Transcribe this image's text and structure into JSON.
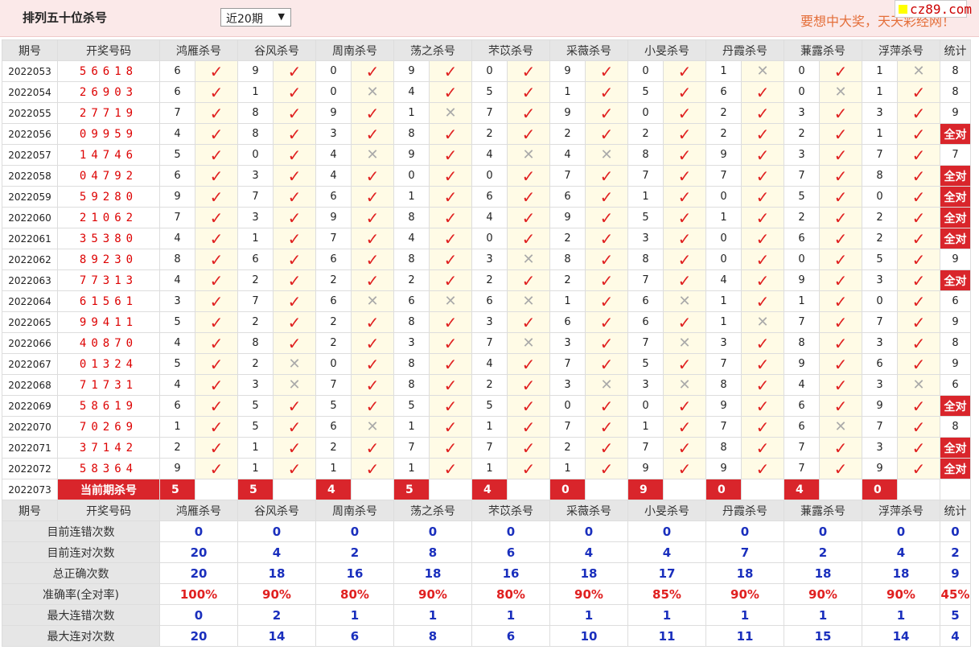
{
  "header": {
    "title": "排列五十位杀号",
    "period_select": "近20期",
    "slogan": "要想中大奖，天天彩经网！",
    "logo": "cz89.com"
  },
  "columns": {
    "period": "期号",
    "open": "开奖号码",
    "experts": [
      "鸿雁杀号",
      "谷风杀号",
      "周南杀号",
      "荡之杀号",
      "芣苡杀号",
      "采薇杀号",
      "小旻杀号",
      "丹霞杀号",
      "蒹露杀号",
      "浮萍杀号"
    ],
    "stat": "统计"
  },
  "all_correct_label": "全对",
  "rows": [
    {
      "period": "2022053",
      "open": "56618",
      "kills": [
        6,
        9,
        0,
        9,
        0,
        9,
        0,
        1,
        0,
        1
      ],
      "ok": [
        1,
        1,
        1,
        1,
        1,
        1,
        1,
        0,
        1,
        0
      ],
      "stat": "8"
    },
    {
      "period": "2022054",
      "open": "26903",
      "kills": [
        6,
        1,
        0,
        4,
        5,
        1,
        5,
        6,
        0,
        1
      ],
      "ok": [
        1,
        1,
        0,
        1,
        1,
        1,
        1,
        1,
        0,
        1
      ],
      "stat": "8"
    },
    {
      "period": "2022055",
      "open": "27719",
      "kills": [
        7,
        8,
        9,
        1,
        7,
        9,
        0,
        2,
        3,
        3
      ],
      "ok": [
        1,
        1,
        1,
        0,
        1,
        1,
        1,
        1,
        1,
        1
      ],
      "stat": "9"
    },
    {
      "period": "2022056",
      "open": "09959",
      "kills": [
        4,
        8,
        3,
        8,
        2,
        2,
        2,
        2,
        2,
        1
      ],
      "ok": [
        1,
        1,
        1,
        1,
        1,
        1,
        1,
        1,
        1,
        1
      ],
      "stat": "全对"
    },
    {
      "period": "2022057",
      "open": "14746",
      "kills": [
        5,
        0,
        4,
        9,
        4,
        4,
        8,
        9,
        3,
        7
      ],
      "ok": [
        1,
        1,
        0,
        1,
        0,
        0,
        1,
        1,
        1,
        1
      ],
      "stat": "7"
    },
    {
      "period": "2022058",
      "open": "04792",
      "kills": [
        6,
        3,
        4,
        0,
        0,
        7,
        7,
        7,
        7,
        8
      ],
      "ok": [
        1,
        1,
        1,
        1,
        1,
        1,
        1,
        1,
        1,
        1
      ],
      "stat": "全对"
    },
    {
      "period": "2022059",
      "open": "59280",
      "kills": [
        9,
        7,
        6,
        1,
        6,
        6,
        1,
        0,
        5,
        0
      ],
      "ok": [
        1,
        1,
        1,
        1,
        1,
        1,
        1,
        1,
        1,
        1
      ],
      "stat": "全对"
    },
    {
      "period": "2022060",
      "open": "21062",
      "kills": [
        7,
        3,
        9,
        8,
        4,
        9,
        5,
        1,
        2,
        2
      ],
      "ok": [
        1,
        1,
        1,
        1,
        1,
        1,
        1,
        1,
        1,
        1
      ],
      "stat": "全对"
    },
    {
      "period": "2022061",
      "open": "35380",
      "kills": [
        4,
        1,
        7,
        4,
        0,
        2,
        3,
        0,
        6,
        2
      ],
      "ok": [
        1,
        1,
        1,
        1,
        1,
        1,
        1,
        1,
        1,
        1
      ],
      "stat": "全对"
    },
    {
      "period": "2022062",
      "open": "89230",
      "kills": [
        8,
        6,
        6,
        8,
        3,
        8,
        8,
        0,
        0,
        5
      ],
      "ok": [
        1,
        1,
        1,
        1,
        0,
        1,
        1,
        1,
        1,
        1
      ],
      "stat": "9"
    },
    {
      "period": "2022063",
      "open": "77313",
      "kills": [
        4,
        2,
        2,
        2,
        2,
        2,
        7,
        4,
        9,
        3
      ],
      "ok": [
        1,
        1,
        1,
        1,
        1,
        1,
        1,
        1,
        1,
        1
      ],
      "stat": "全对"
    },
    {
      "period": "2022064",
      "open": "61561",
      "kills": [
        3,
        7,
        6,
        6,
        6,
        1,
        6,
        1,
        1,
        0
      ],
      "ok": [
        1,
        1,
        0,
        0,
        0,
        1,
        0,
        1,
        1,
        1
      ],
      "stat": "6"
    },
    {
      "period": "2022065",
      "open": "99411",
      "kills": [
        5,
        2,
        2,
        8,
        3,
        6,
        6,
        1,
        7,
        7
      ],
      "ok": [
        1,
        1,
        1,
        1,
        1,
        1,
        1,
        0,
        1,
        1
      ],
      "stat": "9"
    },
    {
      "period": "2022066",
      "open": "40870",
      "kills": [
        4,
        8,
        2,
        3,
        7,
        3,
        7,
        3,
        8,
        3
      ],
      "ok": [
        1,
        1,
        1,
        1,
        0,
        1,
        0,
        1,
        1,
        1
      ],
      "stat": "8"
    },
    {
      "period": "2022067",
      "open": "01324",
      "kills": [
        5,
        2,
        0,
        8,
        4,
        7,
        5,
        7,
        9,
        6
      ],
      "ok": [
        1,
        0,
        1,
        1,
        1,
        1,
        1,
        1,
        1,
        1
      ],
      "stat": "9"
    },
    {
      "period": "2022068",
      "open": "71731",
      "kills": [
        4,
        3,
        7,
        8,
        2,
        3,
        3,
        8,
        4,
        3
      ],
      "ok": [
        1,
        0,
        1,
        1,
        1,
        0,
        0,
        1,
        1,
        0
      ],
      "stat": "6"
    },
    {
      "period": "2022069",
      "open": "58619",
      "kills": [
        6,
        5,
        5,
        5,
        5,
        0,
        0,
        9,
        6,
        9
      ],
      "ok": [
        1,
        1,
        1,
        1,
        1,
        1,
        1,
        1,
        1,
        1
      ],
      "stat": "全对"
    },
    {
      "period": "2022070",
      "open": "70269",
      "kills": [
        1,
        5,
        6,
        1,
        1,
        7,
        1,
        7,
        6,
        7
      ],
      "ok": [
        1,
        1,
        0,
        1,
        1,
        1,
        1,
        1,
        0,
        1
      ],
      "stat": "8"
    },
    {
      "period": "2022071",
      "open": "37142",
      "kills": [
        2,
        1,
        2,
        7,
        7,
        2,
        7,
        8,
        7,
        3
      ],
      "ok": [
        1,
        1,
        1,
        1,
        1,
        1,
        1,
        1,
        1,
        1
      ],
      "stat": "全对"
    },
    {
      "period": "2022072",
      "open": "58364",
      "kills": [
        9,
        1,
        1,
        1,
        1,
        1,
        9,
        9,
        7,
        9
      ],
      "ok": [
        1,
        1,
        1,
        1,
        1,
        1,
        1,
        1,
        1,
        1
      ],
      "stat": "全对"
    }
  ],
  "current": {
    "period": "2022073",
    "label": "当前期杀号",
    "kills": [
      5,
      5,
      4,
      5,
      4,
      0,
      9,
      0,
      4,
      0
    ]
  },
  "summary": [
    {
      "label": "目前连错次数",
      "values": [
        "0",
        "0",
        "0",
        "0",
        "0",
        "0",
        "0",
        "0",
        "0",
        "0"
      ],
      "stat": "0"
    },
    {
      "label": "目前连对次数",
      "values": [
        "20",
        "4",
        "2",
        "8",
        "6",
        "4",
        "4",
        "7",
        "2",
        "4"
      ],
      "stat": "2"
    },
    {
      "label": "总正确次数",
      "values": [
        "20",
        "18",
        "16",
        "18",
        "16",
        "18",
        "17",
        "18",
        "18",
        "18"
      ],
      "stat": "9"
    },
    {
      "label": "准确率(全对率)",
      "values": [
        "100%",
        "90%",
        "80%",
        "90%",
        "80%",
        "90%",
        "85%",
        "90%",
        "90%",
        "90%"
      ],
      "stat": "45%",
      "rate": true
    },
    {
      "label": "最大连错次数",
      "values": [
        "0",
        "2",
        "1",
        "1",
        "1",
        "1",
        "1",
        "1",
        "1",
        "1"
      ],
      "stat": "5"
    },
    {
      "label": "最大连对次数",
      "values": [
        "20",
        "14",
        "6",
        "8",
        "6",
        "10",
        "11",
        "11",
        "15",
        "14"
      ],
      "stat": "4"
    }
  ],
  "icons": {
    "ok": "check-icon",
    "bad": "cross-icon"
  },
  "colors": {
    "accent": "#d9252b",
    "ok": "#e02020",
    "bad": "#aaaaaa",
    "value": "#1a2fbd"
  }
}
